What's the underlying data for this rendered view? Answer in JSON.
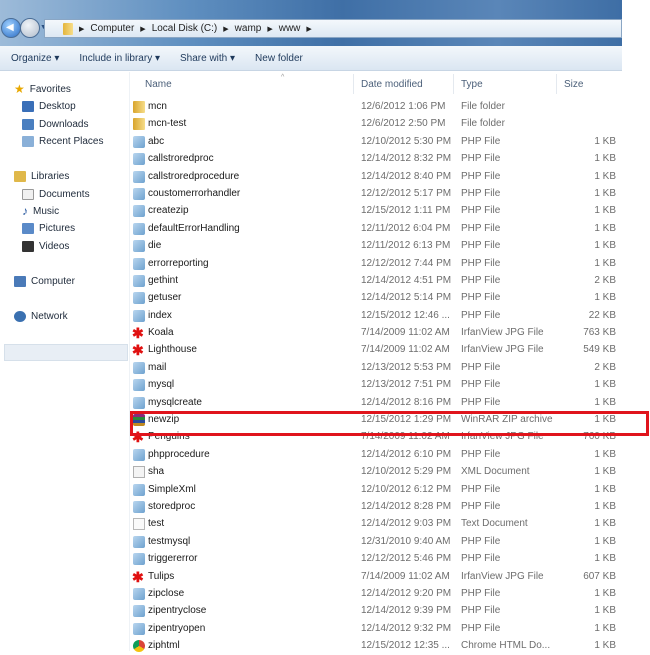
{
  "breadcrumb": [
    "Computer",
    "Local Disk (C:)",
    "wamp",
    "www"
  ],
  "toolbar": {
    "organize": "Organize ▾",
    "include": "Include in library ▾",
    "share": "Share with ▾",
    "newfolder": "New folder"
  },
  "sidebar": {
    "favorites": "Favorites",
    "desktop": "Desktop",
    "downloads": "Downloads",
    "recent": "Recent Places",
    "libraries": "Libraries",
    "documents": "Documents",
    "music": "Music",
    "pictures": "Pictures",
    "videos": "Videos",
    "computer": "Computer",
    "network": "Network"
  },
  "columns": {
    "name": "Name",
    "date": "Date modified",
    "type": "Type",
    "size": "Size"
  },
  "files": [
    {
      "name": "mcn",
      "date": "12/6/2012 1:06 PM",
      "type": "File folder",
      "size": "",
      "icon": "folder"
    },
    {
      "name": "mcn-test",
      "date": "12/6/2012 2:50 PM",
      "type": "File folder",
      "size": "",
      "icon": "folder"
    },
    {
      "name": "abc",
      "date": "12/10/2012 5:30 PM",
      "type": "PHP File",
      "size": "1 KB",
      "icon": "php"
    },
    {
      "name": "callstroredproc",
      "date": "12/14/2012 8:32 PM",
      "type": "PHP File",
      "size": "1 KB",
      "icon": "php"
    },
    {
      "name": "callstroredprocedure",
      "date": "12/14/2012 8:40 PM",
      "type": "PHP File",
      "size": "1 KB",
      "icon": "php"
    },
    {
      "name": "coustomerrorhandler",
      "date": "12/12/2012 5:17 PM",
      "type": "PHP File",
      "size": "1 KB",
      "icon": "php"
    },
    {
      "name": "createzip",
      "date": "12/15/2012 1:11 PM",
      "type": "PHP File",
      "size": "1 KB",
      "icon": "php"
    },
    {
      "name": "defaultErrorHandling",
      "date": "12/11/2012 6:04 PM",
      "type": "PHP File",
      "size": "1 KB",
      "icon": "php"
    },
    {
      "name": "die",
      "date": "12/11/2012 6:13 PM",
      "type": "PHP File",
      "size": "1 KB",
      "icon": "php"
    },
    {
      "name": "errorreporting",
      "date": "12/12/2012 7:44 PM",
      "type": "PHP File",
      "size": "1 KB",
      "icon": "php"
    },
    {
      "name": "gethint",
      "date": "12/14/2012 4:51 PM",
      "type": "PHP File",
      "size": "2 KB",
      "icon": "php"
    },
    {
      "name": "getuser",
      "date": "12/14/2012 5:14 PM",
      "type": "PHP File",
      "size": "1 KB",
      "icon": "php"
    },
    {
      "name": "index",
      "date": "12/15/2012 12:46 ...",
      "type": "PHP File",
      "size": "22 KB",
      "icon": "php"
    },
    {
      "name": "Koala",
      "date": "7/14/2009 11:02 AM",
      "type": "IrfanView JPG File",
      "size": "763 KB",
      "icon": "jpg"
    },
    {
      "name": "Lighthouse",
      "date": "7/14/2009 11:02 AM",
      "type": "IrfanView JPG File",
      "size": "549 KB",
      "icon": "jpg"
    },
    {
      "name": "mail",
      "date": "12/13/2012 5:53 PM",
      "type": "PHP File",
      "size": "2 KB",
      "icon": "php"
    },
    {
      "name": "mysql",
      "date": "12/13/2012 7:51 PM",
      "type": "PHP File",
      "size": "1 KB",
      "icon": "php"
    },
    {
      "name": "mysqlcreate",
      "date": "12/14/2012 8:16 PM",
      "type": "PHP File",
      "size": "1 KB",
      "icon": "php"
    },
    {
      "name": "newzip",
      "date": "12/15/2012 1:29 PM",
      "type": "WinRAR ZIP archive",
      "size": "1 KB",
      "icon": "zip"
    },
    {
      "name": "Penguins",
      "date": "7/14/2009 11:02 AM",
      "type": "IrfanView JPG File",
      "size": "760 KB",
      "icon": "jpg"
    },
    {
      "name": "phpprocedure",
      "date": "12/14/2012 6:10 PM",
      "type": "PHP File",
      "size": "1 KB",
      "icon": "php"
    },
    {
      "name": "sha",
      "date": "12/10/2012 5:29 PM",
      "type": "XML Document",
      "size": "1 KB",
      "icon": "xml"
    },
    {
      "name": "SimpleXml",
      "date": "12/10/2012 6:12 PM",
      "type": "PHP File",
      "size": "1 KB",
      "icon": "php"
    },
    {
      "name": "storedproc",
      "date": "12/14/2012 8:28 PM",
      "type": "PHP File",
      "size": "1 KB",
      "icon": "php"
    },
    {
      "name": "test",
      "date": "12/14/2012 9:03 PM",
      "type": "Text Document",
      "size": "1 KB",
      "icon": "txt"
    },
    {
      "name": "testmysql",
      "date": "12/31/2010 9:40 AM",
      "type": "PHP File",
      "size": "1 KB",
      "icon": "php"
    },
    {
      "name": "triggererror",
      "date": "12/12/2012 5:46 PM",
      "type": "PHP File",
      "size": "1 KB",
      "icon": "php"
    },
    {
      "name": "Tulips",
      "date": "7/14/2009 11:02 AM",
      "type": "IrfanView JPG File",
      "size": "607 KB",
      "icon": "jpg"
    },
    {
      "name": "zipclose",
      "date": "12/14/2012 9:20 PM",
      "type": "PHP File",
      "size": "1 KB",
      "icon": "php"
    },
    {
      "name": "zipentryclose",
      "date": "12/14/2012 9:39 PM",
      "type": "PHP File",
      "size": "1 KB",
      "icon": "php"
    },
    {
      "name": "zipentryopen",
      "date": "12/14/2012 9:32 PM",
      "type": "PHP File",
      "size": "1 KB",
      "icon": "php"
    },
    {
      "name": "ziphtml",
      "date": "12/15/2012 12:35 ...",
      "type": "Chrome HTML Do...",
      "size": "1 KB",
      "icon": "html"
    }
  ],
  "colors": {
    "highlight": "#e0141c"
  }
}
